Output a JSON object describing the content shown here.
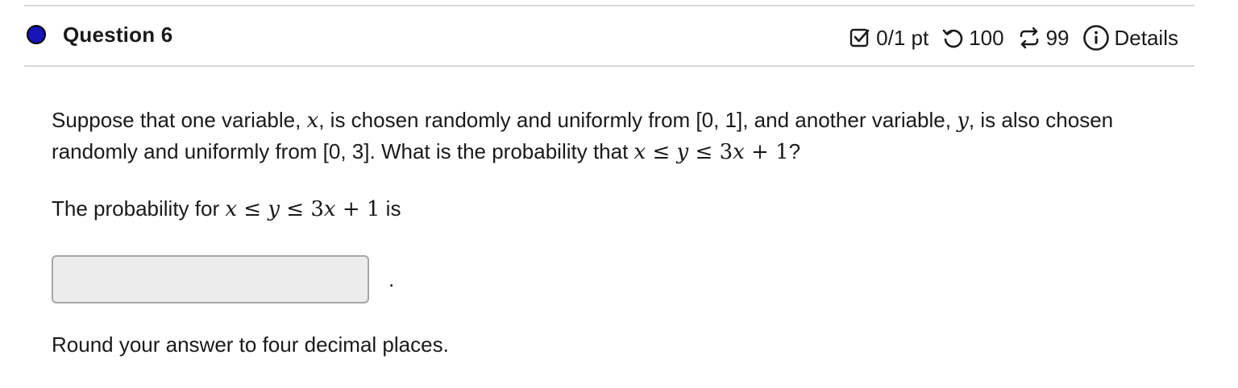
{
  "header": {
    "question_label": "Question 6",
    "points": "0/1 pt",
    "attempts_icon": "undo-icon",
    "attempts": "100",
    "retries_icon": "repeat-icon",
    "retries": "99",
    "details_icon": "info-icon",
    "details_label": "Details",
    "status_color": "#1515b8"
  },
  "question": {
    "p1_a": "Suppose that one variable, ",
    "var_x": "x",
    "p1_b": ", is chosen randomly and uniformly from [0, 1], and another variable, ",
    "var_y": "y",
    "p1_c": ", is also chosen randomly and uniformly from [0, 3]. What is the probability that ",
    "ineq_x": "x",
    "ineq_le1": " ≤ ",
    "ineq_y": "y",
    "ineq_le2": " ≤ ",
    "ineq_3": "3",
    "ineq_x2": "x",
    "ineq_plus1": " + 1",
    "p1_end": "?",
    "p2_a": "The probability for ",
    "p2_b": " is",
    "answer_value": "",
    "answer_period": ".",
    "p3": "Round your answer to four decimal places."
  }
}
